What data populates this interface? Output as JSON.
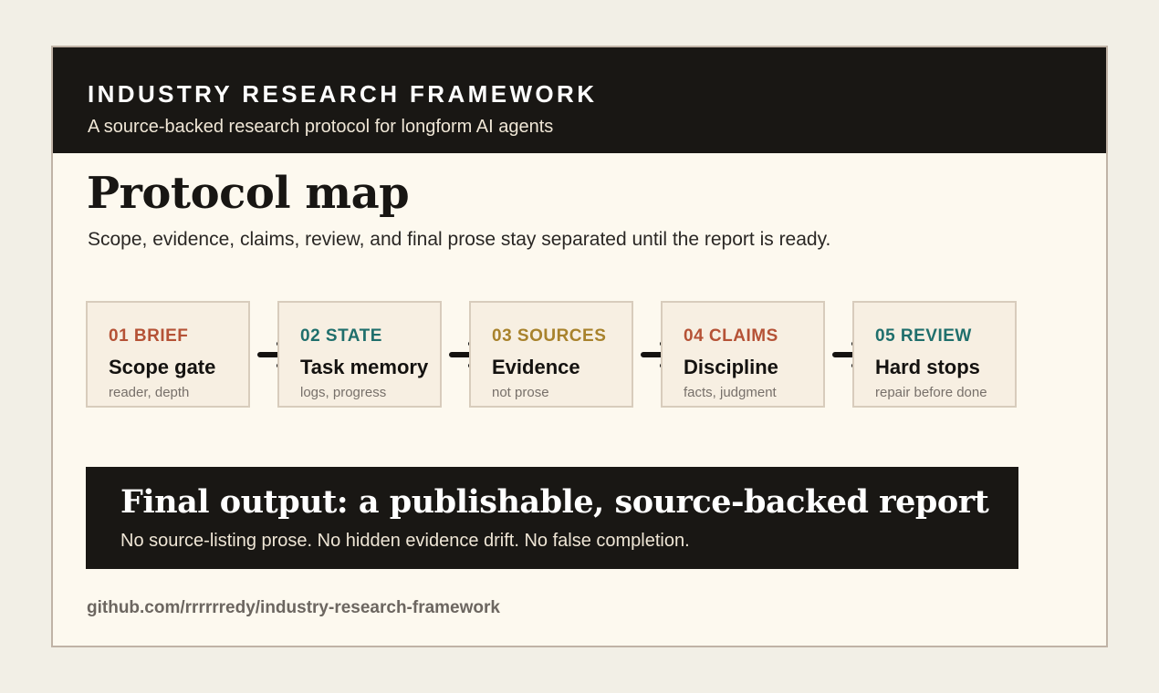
{
  "header": {
    "title": "INDUSTRY RESEARCH FRAMEWORK",
    "subtitle": "A source-backed research protocol for longform AI agents"
  },
  "main": {
    "title": "Protocol map",
    "subtitle": "Scope, evidence, claims, review, and final prose stay separated until the report is ready."
  },
  "steps": [
    {
      "num": "01 BRIEF",
      "title": "Scope gate",
      "note": "reader, depth",
      "color": "#b55236"
    },
    {
      "num": "02 STATE",
      "title": "Task memory",
      "note": "logs, progress",
      "color": "#1f6f6c"
    },
    {
      "num": "03 SOURCES",
      "title": "Evidence",
      "note": "not prose",
      "color": "#a8822c"
    },
    {
      "num": "04 CLAIMS",
      "title": "Discipline",
      "note": "facts, judgment",
      "color": "#b55236"
    },
    {
      "num": "05 REVIEW",
      "title": "Hard stops",
      "note": "repair before done",
      "color": "#1f6f6c"
    }
  ],
  "arrow_icon": "arrow-right-icon",
  "output": {
    "title": "Final output: a publishable, source-backed report",
    "subtitle": "No source-listing prose. No hidden evidence drift. No false completion."
  },
  "footer": {
    "url": "github.com/rrrrrredy/industry-research-framework"
  },
  "colors": {
    "banner": "#191714",
    "card": "#fdf9ef",
    "page": "#f2efe6"
  }
}
